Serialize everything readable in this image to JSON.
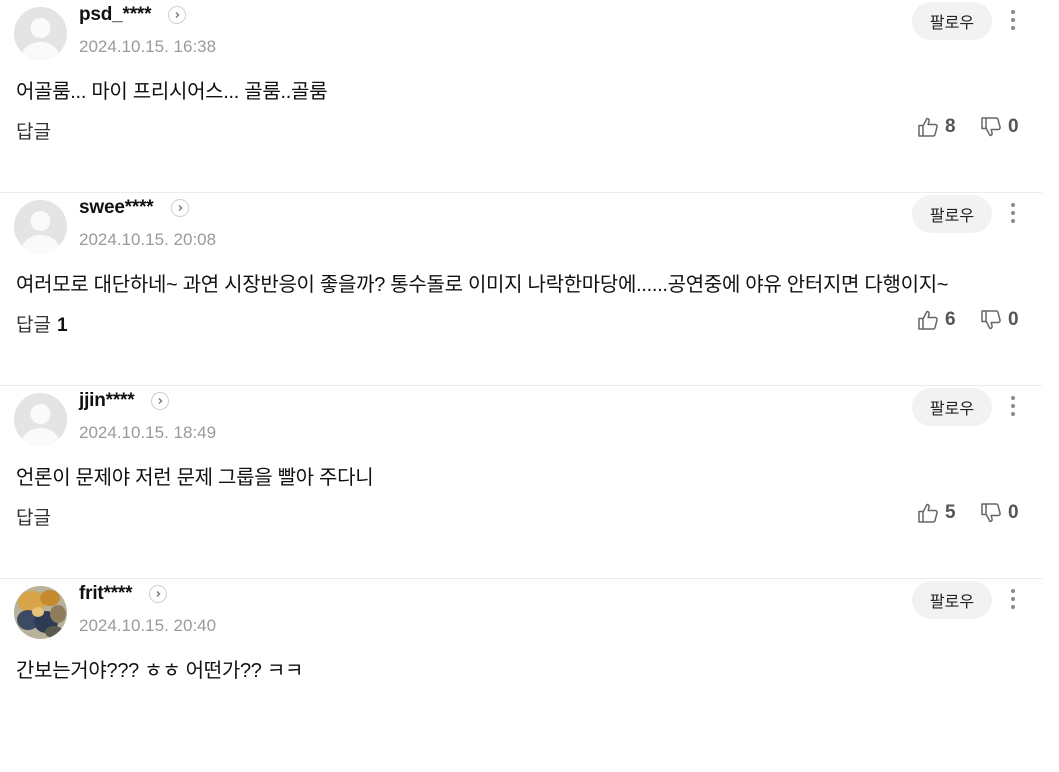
{
  "ui": {
    "follow_label": "팔로우",
    "reply_label": "답글"
  },
  "comments": [
    {
      "username": "psd_****",
      "timestamp": "2024.10.15. 16:38",
      "text": "어골룸... 마이 프리시어스... 골룸..골룸",
      "reply_count": "",
      "likes": "8",
      "dislikes": "0",
      "avatar": "default-avatar-icon"
    },
    {
      "username": "swee****",
      "timestamp": "2024.10.15. 20:08",
      "text": "여러모로 대단하네~ 과연 시장반응이 좋을까? 통수돌로 이미지 나락한마당에......공연중에 야유 안터지면 다행이지~",
      "reply_count": "1",
      "likes": "6",
      "dislikes": "0",
      "avatar": "default-avatar-icon"
    },
    {
      "username": "jjin****",
      "timestamp": "2024.10.15. 18:49",
      "text": "언론이 문제야 저런 문제 그룹을 빨아 주다니",
      "reply_count": "",
      "likes": "5",
      "dislikes": "0",
      "avatar": "default-avatar-icon"
    },
    {
      "username": "frit****",
      "timestamp": "2024.10.15. 20:40",
      "text": "간보는거야??? ㅎㅎ 어떤가?? ㅋㅋ",
      "reply_count": "",
      "likes": "",
      "dislikes": "",
      "avatar": "photo-avatar"
    }
  ]
}
